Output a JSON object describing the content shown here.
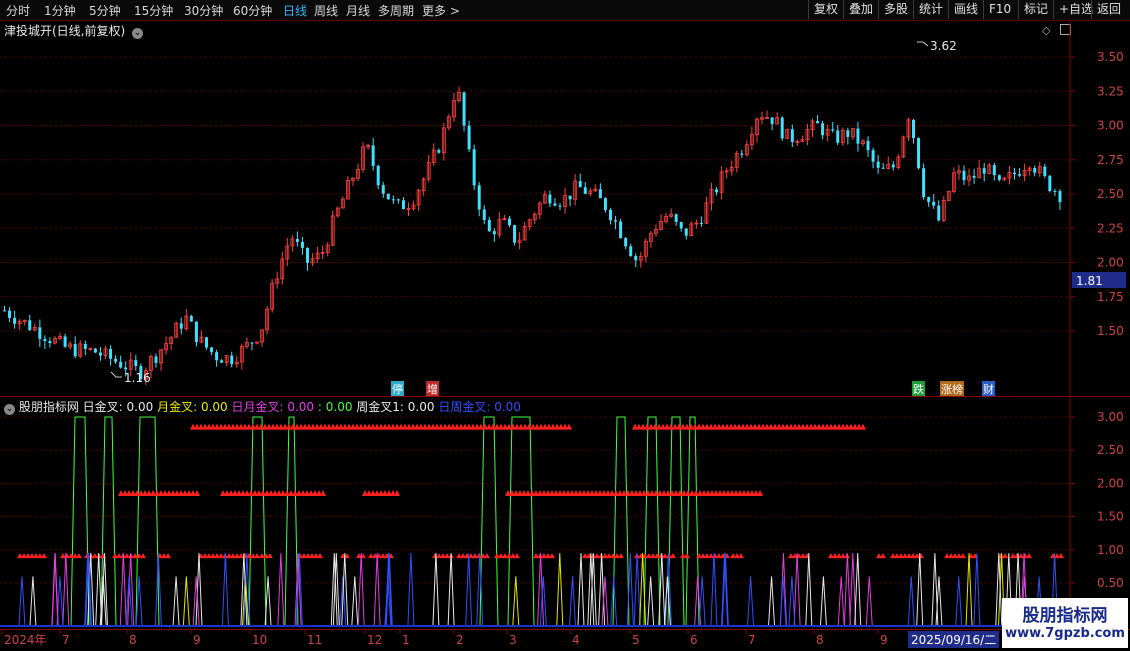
{
  "toolbar": {
    "left": [
      "分时",
      "1分钟",
      "5分钟",
      "15分钟",
      "30分钟",
      "60分钟",
      "日线",
      "周线",
      "月线",
      "多周期",
      "更多 >"
    ],
    "active": "日线",
    "right": [
      "复权",
      "叠加",
      "多股",
      "统计",
      "画线",
      "F10",
      "标记",
      "+自选",
      "返回"
    ]
  },
  "main": {
    "title": "津投城开(日线,前复权)",
    "y_ticks": [
      "3.50",
      "3.25",
      "3.00",
      "2.75",
      "2.50",
      "2.25",
      "2.00",
      "1.75",
      "1.50"
    ],
    "current_price": "1.81",
    "high_label": "3.62",
    "low_label": "1.16",
    "markers": [
      {
        "text": "停",
        "color": "#2aa9c9"
      },
      {
        "text": "增",
        "color": "#c02a2a"
      },
      {
        "text": "跌",
        "color": "#1f9d3a"
      },
      {
        "text": "涨榜",
        "color": "#b06a1a"
      },
      {
        "text": "财",
        "color": "#2a5fc9"
      }
    ]
  },
  "indicator": {
    "name": "股朋指标网",
    "legend": [
      {
        "label": "日金叉: ",
        "value": "0.00",
        "color": "#e8e8e8"
      },
      {
        "label": "月金叉: ",
        "value": "0.00",
        "color": "#e8e800"
      },
      {
        "label": "日月金叉: ",
        "value": "0.00",
        "color": "#e040e0"
      },
      {
        "label": ": ",
        "value": "0.00",
        "color": "#40ff40"
      },
      {
        "label": "周金叉1: ",
        "value": "0.00",
        "color": "#e8e8e8"
      },
      {
        "label": "日周金叉: ",
        "value": "0.00",
        "color": "#3050ff"
      }
    ],
    "y_ticks": [
      "3.00",
      "2.50",
      "2.00",
      "1.50",
      "1.00",
      "0.50"
    ]
  },
  "xaxis": {
    "labels": [
      "2024年",
      "7",
      "8",
      "9",
      "10",
      "11",
      "12",
      "1",
      "2",
      "3",
      "4",
      "5",
      "6",
      "7",
      "8",
      "9"
    ],
    "current_date": "2025/09/16/二"
  },
  "watermark": {
    "line1": "股朋指标网",
    "line2": "www.7gpzb.com"
  },
  "chart_data": {
    "type": "candlestick",
    "title": "津投城开(日线,前复权)",
    "ylim": [
      1.2,
      3.7
    ],
    "annotations": {
      "high": 3.62,
      "low": 1.16,
      "current": 1.81
    },
    "close_path": [
      1.65,
      1.58,
      1.52,
      1.45,
      1.38,
      1.36,
      1.35,
      1.3,
      1.25,
      1.2,
      1.32,
      1.45,
      1.6,
      1.42,
      1.32,
      1.3,
      1.38,
      1.5,
      1.9,
      2.2,
      2.0,
      2.05,
      2.35,
      2.6,
      2.85,
      2.55,
      2.4,
      2.45,
      2.65,
      2.9,
      3.3,
      2.65,
      2.2,
      2.3,
      2.15,
      2.35,
      2.5,
      2.45,
      2.55,
      2.5,
      2.4,
      2.2,
      2.0,
      2.25,
      2.35,
      2.2,
      2.3,
      2.5,
      2.7,
      2.85,
      3.1,
      3.05,
      2.9,
      2.95,
      3.0,
      2.9,
      2.95,
      2.85,
      2.65,
      2.7,
      3.1,
      2.5,
      2.3,
      2.65,
      2.6,
      2.7,
      2.55,
      2.65,
      2.75,
      2.6,
      2.5
    ]
  }
}
